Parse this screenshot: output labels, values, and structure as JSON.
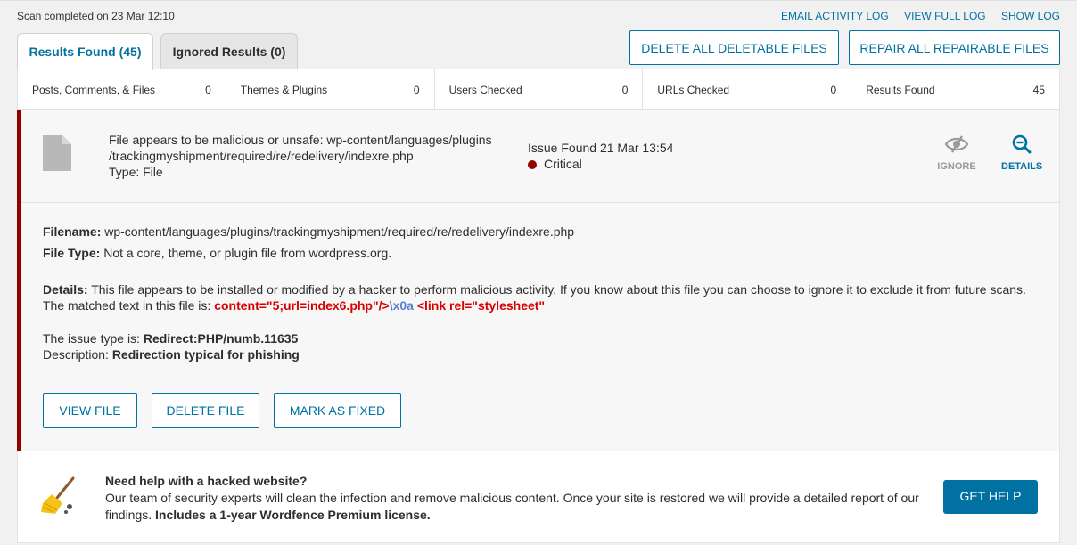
{
  "header": {
    "scan_status": "Scan completed on 23 Mar 12:10",
    "links": [
      "EMAIL ACTIVITY LOG",
      "VIEW FULL LOG",
      "SHOW LOG"
    ]
  },
  "tabs": [
    {
      "label": "Results Found (45)",
      "active": true
    },
    {
      "label": "Ignored Results (0)",
      "active": false
    }
  ],
  "bulk_actions": {
    "delete_all": "DELETE ALL DELETABLE FILES",
    "repair_all": "REPAIR ALL REPAIRABLE FILES"
  },
  "stats": [
    {
      "label": "Posts, Comments, & Files",
      "value": "0"
    },
    {
      "label": "Themes & Plugins",
      "value": "0"
    },
    {
      "label": "Users Checked",
      "value": "0"
    },
    {
      "label": "URLs Checked",
      "value": "0"
    },
    {
      "label": "Results Found",
      "value": "45"
    }
  ],
  "issue": {
    "title_line1": "File appears to be malicious or unsafe: wp-content/languages/plugins",
    "title_line2": "/trackingmyshipment/required/re/redelivery/indexre.php",
    "type_line": "Type: File",
    "found": "Issue Found 21 Mar 13:54",
    "severity": "Critical",
    "severity_color": "#930000",
    "ignore_label": "IGNORE",
    "details_label": "DETAILS",
    "filename_label": "Filename:",
    "filename": "wp-content/languages/plugins/trackingmyshipment/required/re/redelivery/indexre.php",
    "filetype_label": "File Type:",
    "filetype": "Not a core, theme, or plugin file from wordpress.org.",
    "details_label_body": "Details:",
    "details_text": "This file appears to be installed or modified by a hacker to perform malicious activity. If you know about this file you can choose to ignore it to exclude it from future scans.",
    "matched_prefix": "The matched text in this file is:",
    "matched_part1": "content=\"5;url=index6.php\"/>",
    "matched_part2": "\\x0a",
    "matched_part3": " <link rel=\"stylesheet\"",
    "issue_type_label": "The issue type is:",
    "issue_type": "Redirect:PHP/numb.11635",
    "description_label": "Description:",
    "description": "Redirection typical for phishing",
    "buttons": {
      "view": "VIEW FILE",
      "delete": "DELETE FILE",
      "fixed": "MARK AS FIXED"
    }
  },
  "help": {
    "title": "Need help with a hacked website?",
    "text": "Our team of security experts will clean the infection and remove malicious content. Once your site is restored we will provide a detailed report of our findings.",
    "bold_tail": "Includes a 1-year Wordfence Premium license.",
    "button": "GET HELP"
  },
  "colors": {
    "accent": "#0071a1",
    "critical": "#930000",
    "match_red": "#d80000",
    "match_blue": "#5b7fd1"
  }
}
